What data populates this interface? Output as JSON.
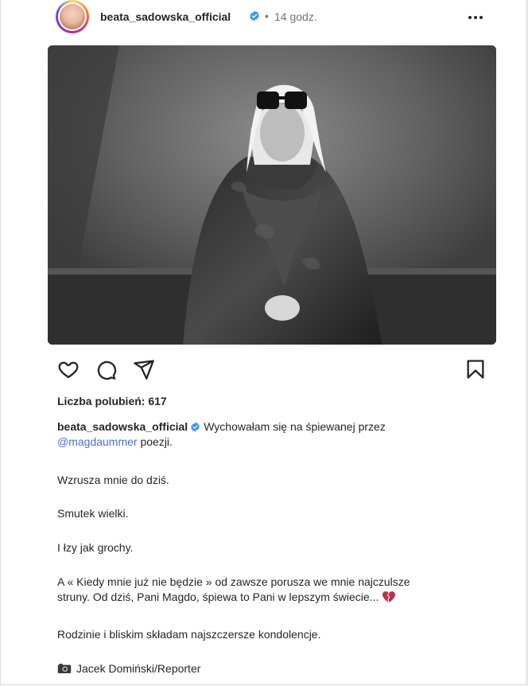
{
  "post": {
    "username": "beata_sadowska_official",
    "separator": "•",
    "time": "14 godz.",
    "likes": "Liczba polubień: 617",
    "caption_user": "beata_sadowska_official",
    "caption_line1": "Wychowałam się na śpiewanej przez",
    "mention": "@magdaummer",
    "caption_line1_end": " poezji.",
    "p2": "Wzrusza mnie do dziś.",
    "p3": "Smutek wielki.",
    "p4": "I łzy jak grochy.",
    "p5_line1": "A « Kiedy mnie już nie będzie » od zawsze porusza we mnie najczulsze",
    "p5_line2": "struny. Od dziś, Pani Magdo, śpiewa to Pani w lepszym świecie...",
    "p6": "Rodzinie i bliskim składam najszczersze kondolencje.",
    "credit": "Jacek Domiński/Reporter"
  },
  "icons": {
    "verified": "verified-badge-icon",
    "more": "more-options-icon",
    "like": "heart-outline-icon",
    "comment": "comment-bubble-icon",
    "share": "paper-plane-icon",
    "save": "bookmark-icon",
    "emoji_heart": "broken-heart-emoji",
    "emoji_camera": "camera-emoji"
  },
  "colors": {
    "verified_blue": "#3897f0",
    "mention_blue": "#4a6fd0",
    "heart_red": "#c0304a"
  }
}
